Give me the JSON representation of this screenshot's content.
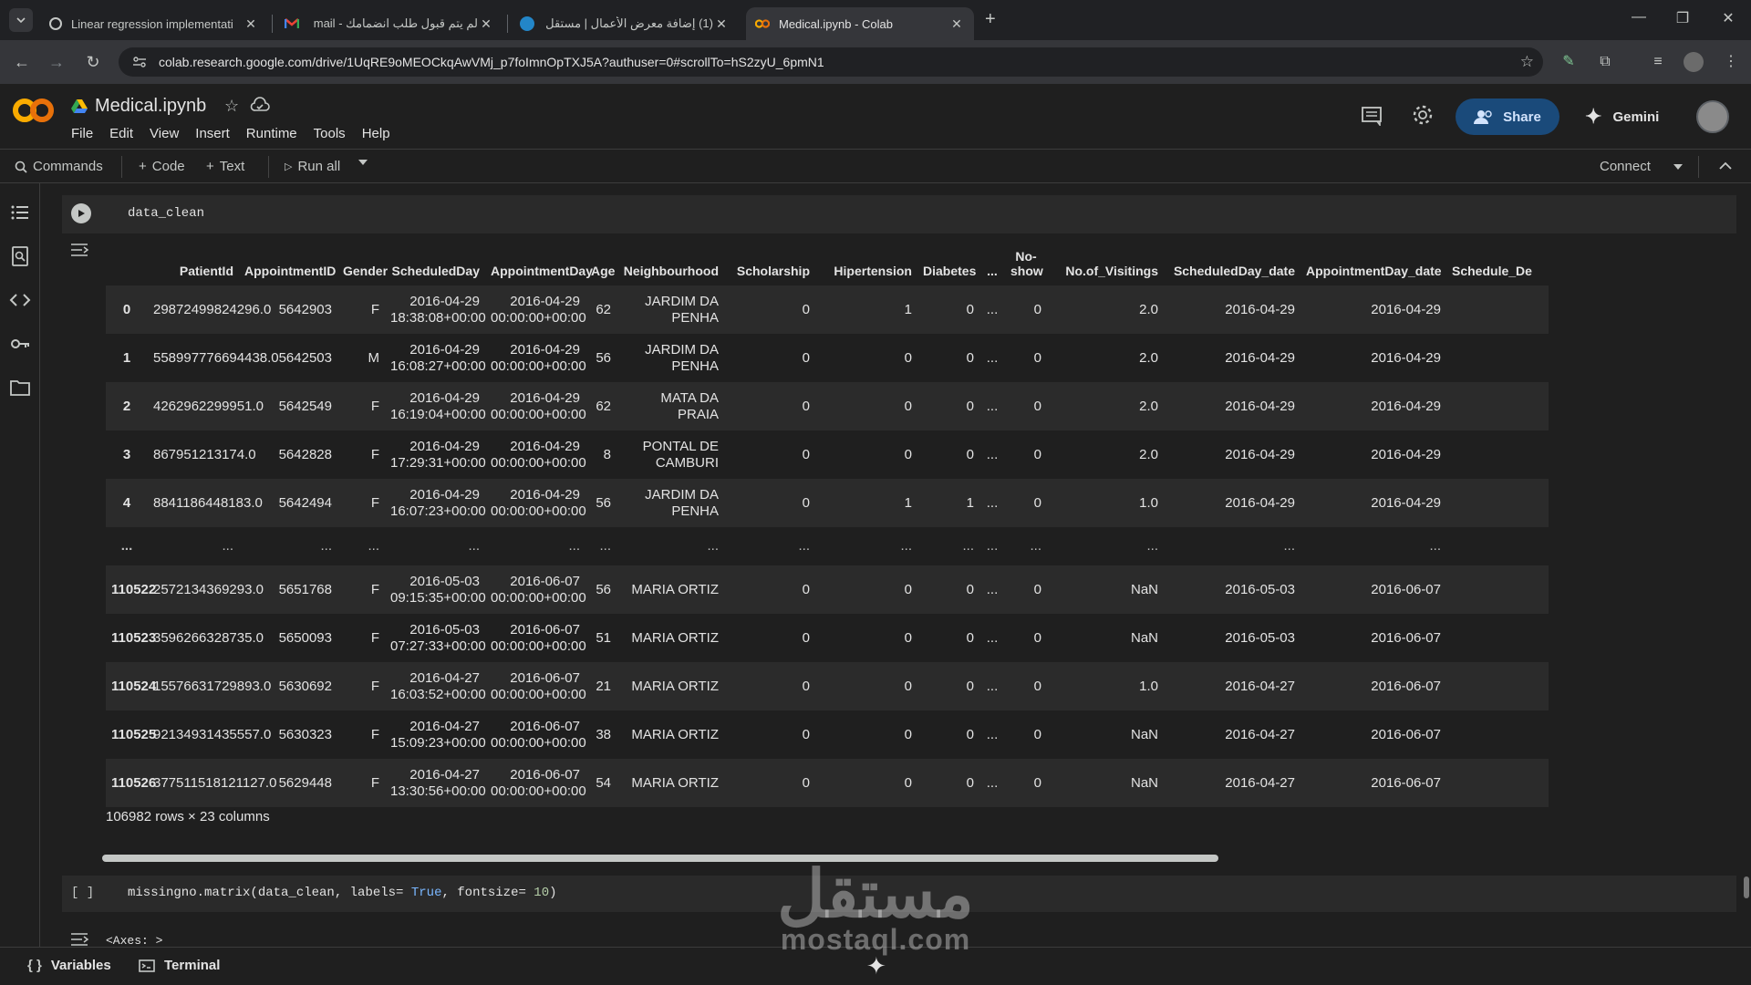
{
  "browser": {
    "tabs": [
      {
        "title": "Linear regression implementati",
        "favicon": "openai-icon"
      },
      {
        "title": "لم يتم قبول طلب انضمامك - mail",
        "favicon": "gmail-icon"
      },
      {
        "title": "(1) إضافة معرض الأعمال | مستقل",
        "favicon": "mostaql-icon"
      },
      {
        "title": "Medical.ipynb - Colab",
        "favicon": "colab-icon",
        "active": true
      }
    ],
    "url": "colab.research.google.com/drive/1UqRE9oMEOCkqAwVMj_p7foImnOpTXJ5A?authuser=0#scrollTo=hS2zyU_6pmN1"
  },
  "colab": {
    "title": "Medical.ipynb",
    "menu": [
      "File",
      "Edit",
      "View",
      "Insert",
      "Runtime",
      "Tools",
      "Help"
    ],
    "share_label": "Share",
    "gemini_label": "Gemini",
    "toolbar": {
      "commands": "Commands",
      "add_code": "Code",
      "add_text": "Text",
      "run_all": "Run all",
      "connect": "Connect"
    }
  },
  "cell1": {
    "code": "data_clean"
  },
  "dataframe": {
    "columns": [
      "",
      "PatientId",
      "AppointmentID",
      "Gender",
      "ScheduledDay",
      "AppointmentDay",
      "Age",
      "Neighbourhood",
      "Scholarship",
      "Hipertension",
      "Diabetes",
      "...",
      "No-show",
      "No.of_Visitings",
      "ScheduledDay_date",
      "AppointmentDay_date",
      "Schedule_De"
    ],
    "rows": [
      [
        "0",
        "29872499824296.0",
        "5642903",
        "F",
        "2016-04-29 18:38:08+00:00",
        "2016-04-29 00:00:00+00:00",
        "62",
        "JARDIM DA PENHA",
        "0",
        "1",
        "0",
        "...",
        "0",
        "2.0",
        "2016-04-29",
        "2016-04-29",
        ""
      ],
      [
        "1",
        "558997776694438.0",
        "5642503",
        "M",
        "2016-04-29 16:08:27+00:00",
        "2016-04-29 00:00:00+00:00",
        "56",
        "JARDIM DA PENHA",
        "0",
        "0",
        "0",
        "...",
        "0",
        "2.0",
        "2016-04-29",
        "2016-04-29",
        ""
      ],
      [
        "2",
        "4262962299951.0",
        "5642549",
        "F",
        "2016-04-29 16:19:04+00:00",
        "2016-04-29 00:00:00+00:00",
        "62",
        "MATA DA PRAIA",
        "0",
        "0",
        "0",
        "...",
        "0",
        "2.0",
        "2016-04-29",
        "2016-04-29",
        ""
      ],
      [
        "3",
        "867951213174.0",
        "5642828",
        "F",
        "2016-04-29 17:29:31+00:00",
        "2016-04-29 00:00:00+00:00",
        "8",
        "PONTAL DE CAMBURI",
        "0",
        "0",
        "0",
        "...",
        "0",
        "2.0",
        "2016-04-29",
        "2016-04-29",
        ""
      ],
      [
        "4",
        "8841186448183.0",
        "5642494",
        "F",
        "2016-04-29 16:07:23+00:00",
        "2016-04-29 00:00:00+00:00",
        "56",
        "JARDIM DA PENHA",
        "0",
        "1",
        "1",
        "...",
        "0",
        "1.0",
        "2016-04-29",
        "2016-04-29",
        ""
      ],
      [
        "...",
        "...",
        "...",
        "...",
        "...",
        "...",
        "...",
        "...",
        "...",
        "...",
        "...",
        "...",
        "...",
        "...",
        "...",
        "...",
        ""
      ],
      [
        "110522",
        "2572134369293.0",
        "5651768",
        "F",
        "2016-05-03 09:15:35+00:00",
        "2016-06-07 00:00:00+00:00",
        "56",
        "MARIA ORTIZ",
        "0",
        "0",
        "0",
        "...",
        "0",
        "NaN",
        "2016-05-03",
        "2016-06-07",
        ""
      ],
      [
        "110523",
        "3596266328735.0",
        "5650093",
        "F",
        "2016-05-03 07:27:33+00:00",
        "2016-06-07 00:00:00+00:00",
        "51",
        "MARIA ORTIZ",
        "0",
        "0",
        "0",
        "...",
        "0",
        "NaN",
        "2016-05-03",
        "2016-06-07",
        ""
      ],
      [
        "110524",
        "15576631729893.0",
        "5630692",
        "F",
        "2016-04-27 16:03:52+00:00",
        "2016-06-07 00:00:00+00:00",
        "21",
        "MARIA ORTIZ",
        "0",
        "0",
        "0",
        "...",
        "0",
        "1.0",
        "2016-04-27",
        "2016-06-07",
        ""
      ],
      [
        "110525",
        "92134931435557.0",
        "5630323",
        "F",
        "2016-04-27 15:09:23+00:00",
        "2016-06-07 00:00:00+00:00",
        "38",
        "MARIA ORTIZ",
        "0",
        "0",
        "0",
        "...",
        "0",
        "NaN",
        "2016-04-27",
        "2016-06-07",
        ""
      ],
      [
        "110526",
        "377511518121127.0",
        "5629448",
        "F",
        "2016-04-27 13:30:56+00:00",
        "2016-06-07 00:00:00+00:00",
        "54",
        "MARIA ORTIZ",
        "0",
        "0",
        "0",
        "...",
        "0",
        "NaN",
        "2016-04-27",
        "2016-06-07",
        ""
      ]
    ],
    "shape_text": "106982 rows × 23 columns"
  },
  "cell2": {
    "bracket": "[ ]",
    "code_parts": [
      "missingno.matrix(data_clean, labels= ",
      "True",
      ", fontsize= ",
      "10",
      ")"
    ],
    "output": "<Axes: >"
  },
  "bottombar": {
    "variables": "Variables",
    "terminal": "Terminal"
  },
  "watermark": {
    "arabic": "مستقل",
    "latin": "mostaql.com"
  }
}
